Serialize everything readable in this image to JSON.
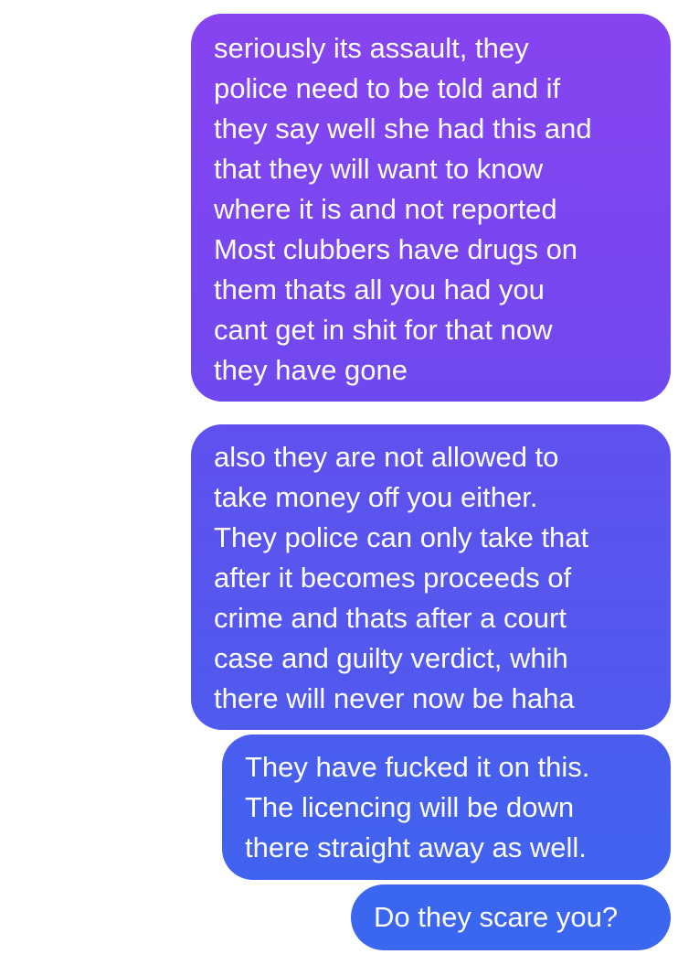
{
  "messages": [
    {
      "lines": [
        "seriously its assault, they",
        "police need to be told and if",
        "they say well she had this and",
        "that they will want to know",
        "where it is and not reported",
        "Most clubbers have drugs on",
        "them thats all you had you",
        "cant get in shit for that now",
        "they have gone"
      ]
    },
    {
      "lines": [
        "also they are not allowed to",
        "take money off you either.",
        "They police can only take that",
        "after it becomes proceeds of",
        "crime and thats after a court",
        "case and guilty verdict, whih",
        "there will never now be haha"
      ]
    },
    {
      "lines": [
        "They have fucked it on this.",
        "The licencing will be down",
        "there straight away as well."
      ]
    },
    {
      "lines": [
        "Do they scare you?"
      ]
    }
  ],
  "colors": {
    "bubble_top": "#8744f0",
    "bubble_bottom": "#3b66ef",
    "text": "#ffffff",
    "background": "#ffffff"
  }
}
